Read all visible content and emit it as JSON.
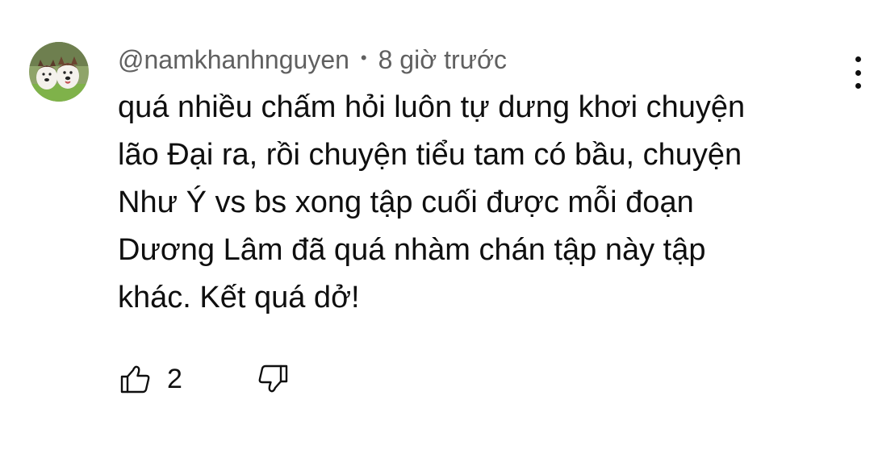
{
  "comment": {
    "author": "@namkhanhnguyen",
    "separator": "•",
    "timestamp": "8 giờ trước",
    "text_lines": [
      "quá nhiều chấm hỏi luôn tự dưng khơi chuyện",
      "lão Đại ra, rồi chuyện tiểu tam có bầu, chuyện",
      "Như Ý vs bs xong tập cuối được mỗi đoạn",
      "Dương Lâm đã quá nhàm chán tập này tập",
      "khác. Kết quá dở!"
    ],
    "like_count": "2",
    "avatar_icon": "husky-dogs-avatar"
  },
  "icons": {
    "like": "thumbs-up-icon",
    "dislike": "thumbs-down-icon",
    "more": "more-vertical-icon"
  },
  "colors": {
    "text": "#0f0f0f",
    "meta": "#606060",
    "background": "#ffffff"
  }
}
